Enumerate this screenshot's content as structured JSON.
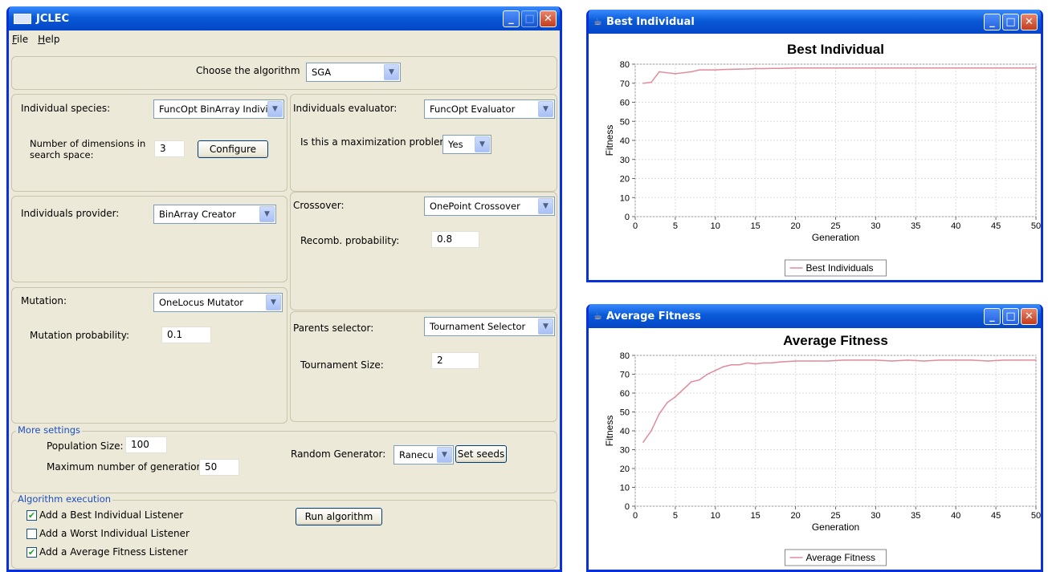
{
  "main": {
    "title": "JCLEC",
    "menu": [
      "File",
      "Help"
    ],
    "algorithm_label": "Choose the algorithm",
    "algorithm_value": "SGA",
    "species_label": "Individual species:",
    "species_value": "FuncOpt BinArray Individ",
    "dims_label_1": "Number of dimensions in",
    "dims_label_2": "search space:",
    "dims_value": "3",
    "configure": "Configure",
    "evaluator_label": "Individuals evaluator:",
    "evaluator_value": "FuncOpt Evaluator",
    "max_label": "Is this a maximization problem?",
    "max_value": "Yes",
    "provider_label": "Individuals provider:",
    "provider_value": "BinArray Creator",
    "crossover_label": "Crossover:",
    "crossover_value": "OnePoint Crossover",
    "recomb_label": "Recomb. probability:",
    "recomb_value": "0.8",
    "mutation_label": "Mutation:",
    "mutation_value": "OneLocus Mutator",
    "mutprob_label": "Mutation probability:",
    "mutprob_value": "0.1",
    "parents_label": "Parents selector:",
    "parents_value": "Tournament Selector",
    "tourn_label": "Tournament Size:",
    "tourn_value": "2",
    "more_settings": "More settings",
    "pop_label": "Population Size:",
    "pop_value": "100",
    "maxgen_label": "Maximum number of generations",
    "maxgen_value": "50",
    "random_label": "Random Generator:",
    "random_value": "Ranecu",
    "set_seeds": "Set seeds",
    "exec_label": "Algorithm execution",
    "chk_best": "Add a Best Individual Listener",
    "chk_worst": "Add a Worst Individual Listener",
    "chk_avg": "Add a Average Fitness Listener",
    "chk_best_checked": true,
    "chk_worst_checked": false,
    "chk_avg_checked": true,
    "run": "Run algorithm"
  },
  "chart_data": [
    {
      "type": "line",
      "window_title": "Best Individual",
      "title": "Best Individual",
      "xlabel": "Generation",
      "ylabel": "Fitness",
      "xlim": [
        0,
        50
      ],
      "ylim": [
        0,
        80
      ],
      "xticks": [
        0,
        5,
        10,
        15,
        20,
        25,
        30,
        35,
        40,
        45,
        50
      ],
      "yticks": [
        0,
        10,
        20,
        30,
        40,
        50,
        60,
        70,
        80
      ],
      "grid": true,
      "legend_position": "bottom",
      "series": [
        {
          "name": "Best Individuals",
          "color": "#e08a9a",
          "x": [
            1,
            2,
            3,
            4,
            5,
            6,
            7,
            8,
            9,
            10,
            11,
            12,
            13,
            14,
            15,
            16,
            17,
            18,
            19,
            20,
            25,
            30,
            35,
            40,
            45,
            50
          ],
          "y": [
            70,
            70.5,
            76,
            75.5,
            75,
            75.5,
            76,
            77,
            77,
            77,
            77.2,
            77.3,
            77.4,
            77.5,
            77.7,
            77.7,
            77.8,
            77.8,
            77.9,
            78,
            78,
            78,
            78,
            78,
            78,
            78
          ]
        }
      ]
    },
    {
      "type": "line",
      "window_title": "Average Fitness",
      "title": "Average Fitness",
      "xlabel": "Generation",
      "ylabel": "Fitness",
      "xlim": [
        0,
        50
      ],
      "ylim": [
        0,
        80
      ],
      "xticks": [
        0,
        5,
        10,
        15,
        20,
        25,
        30,
        35,
        40,
        45,
        50
      ],
      "yticks": [
        0,
        10,
        20,
        30,
        40,
        50,
        60,
        70,
        80
      ],
      "grid": true,
      "legend_position": "bottom",
      "series": [
        {
          "name": "Average Fitness",
          "color": "#e08a9a",
          "x": [
            1,
            2,
            3,
            4,
            5,
            6,
            7,
            8,
            9,
            10,
            11,
            12,
            13,
            14,
            15,
            16,
            17,
            18,
            20,
            22,
            24,
            26,
            28,
            30,
            32,
            34,
            36,
            38,
            40,
            42,
            44,
            46,
            48,
            50
          ],
          "y": [
            34,
            40,
            49,
            55,
            58,
            62,
            66,
            67,
            70,
            72,
            74,
            75,
            75,
            76,
            75.5,
            76,
            76,
            76.5,
            77,
            77,
            77,
            77.5,
            77.5,
            77.5,
            77,
            77.5,
            77,
            77.5,
            77.5,
            77.5,
            77,
            77.5,
            77.5,
            77.5
          ]
        }
      ]
    }
  ],
  "colors": {
    "titlebar": "#0a5ad8",
    "window_bg": "#ece9d8",
    "series": "#e08a9a",
    "group_text": "#1c4fc0"
  },
  "icons": {
    "minimize": "minimize-icon",
    "maximize": "maximize-icon",
    "close": "close-icon",
    "dropdown": "chevron-down-icon",
    "check": "checkmark-icon"
  }
}
